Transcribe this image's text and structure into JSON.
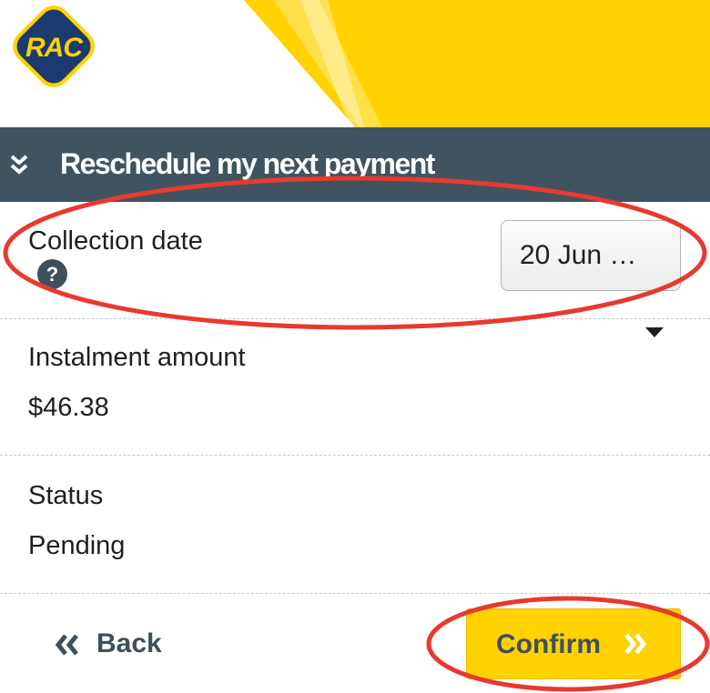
{
  "brand": {
    "logo_text": "RAC",
    "colors": {
      "yellow": "#ffd200",
      "navy": "#1b3b6f",
      "slate": "#405360",
      "annotation": "#e8392f"
    }
  },
  "page": {
    "title": "Reschedule my next payment",
    "title_icon": "double-chevron-down-icon"
  },
  "collection_date": {
    "label": "Collection date",
    "help_icon": "help-icon",
    "help_glyph": "?",
    "selected_value": "20 Jun …"
  },
  "instalment": {
    "label": "Instalment amount",
    "value": "$46.38"
  },
  "status": {
    "label": "Status",
    "value": "Pending"
  },
  "actions": {
    "back_label": "Back",
    "back_icon": "double-chevron-left-icon",
    "confirm_label": "Confirm",
    "confirm_icon": "double-chevron-right-icon"
  }
}
